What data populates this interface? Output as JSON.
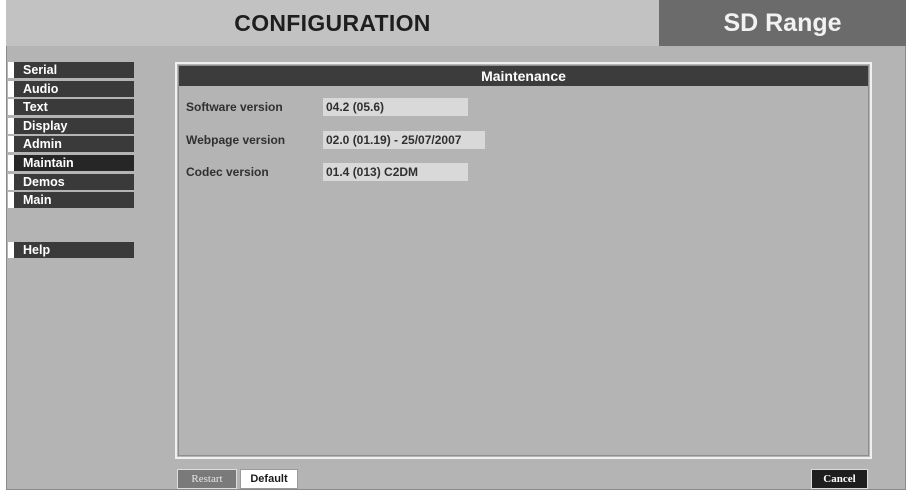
{
  "header": {
    "title": "CONFIGURATION",
    "product": "SD Range"
  },
  "nav": {
    "items": [
      {
        "label": "Serial"
      },
      {
        "label": "Audio"
      },
      {
        "label": "Text"
      },
      {
        "label": "Display"
      },
      {
        "label": "Admin"
      },
      {
        "label": "Maintain",
        "active": true
      },
      {
        "label": "Demos"
      },
      {
        "label": "Main"
      }
    ],
    "help": "Help"
  },
  "panel": {
    "title": "Maintenance",
    "fields": [
      {
        "label": "Software version",
        "value": "04.2 (05.6)"
      },
      {
        "label": "Webpage version",
        "value": "02.0 (01.19) - 25/07/2007"
      },
      {
        "label": "Codec version",
        "value": "01.4 (013) C2DM"
      }
    ]
  },
  "buttons": {
    "restart": "Restart",
    "default": "Default",
    "cancel": "Cancel"
  }
}
